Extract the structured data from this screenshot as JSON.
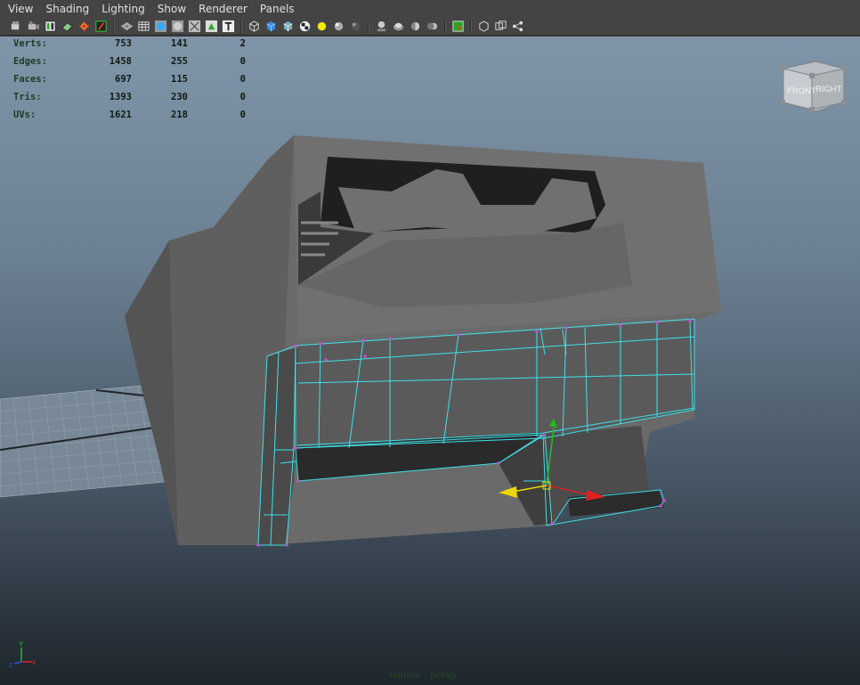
{
  "menu": {
    "items": [
      {
        "id": "view",
        "label": "View"
      },
      {
        "id": "shading",
        "label": "Shading"
      },
      {
        "id": "lighting",
        "label": "Lighting"
      },
      {
        "id": "show",
        "label": "Show"
      },
      {
        "id": "renderer",
        "label": "Renderer"
      },
      {
        "id": "panels",
        "label": "Panels"
      }
    ]
  },
  "toolbar": {
    "icons": [
      "camera-select-icon",
      "camera-attributes-icon",
      "bookmark-icon",
      "image-plane-icon",
      "grid-pivot-icon",
      "film-gate-icon",
      "wireframe-icon",
      "grid-toggle-icon",
      "smooth-shade-icon",
      "flat-shade-icon",
      "xray-icon",
      "textured-icon",
      "text-icon",
      "cube-wire-icon",
      "cube-shaded-icon",
      "cube-textured-icon",
      "checker-icon",
      "light-bulb-icon",
      "sphere-lit-icon",
      "sphere-dark-icon",
      "isolate-icon",
      "shadows-icon",
      "ambient-occlusion-icon",
      "motion-blur-icon",
      "select-camera-icon",
      "single-view-icon",
      "two-views-icon",
      "share-icon"
    ]
  },
  "hud": {
    "rows": [
      {
        "label": "Verts:",
        "c1": "753",
        "c2": "141",
        "c3": "2"
      },
      {
        "label": "Edges:",
        "c1": "1458",
        "c2": "255",
        "c3": "0"
      },
      {
        "label": "Faces:",
        "c1": "697",
        "c2": "115",
        "c3": "0"
      },
      {
        "label": "Tris:",
        "c1": "1393",
        "c2": "230",
        "c3": "0"
      },
      {
        "label": "UVs:",
        "c1": "1621",
        "c2": "218",
        "c3": "0"
      }
    ]
  },
  "viewcube": {
    "front_label": "FRONT",
    "right_label": "RIGHT"
  },
  "axis": {
    "y": "Y",
    "z": "z",
    "x": "x"
  },
  "status": {
    "isolate": "Isolate : persp"
  },
  "colors": {
    "wireframe": "#3fe0e8",
    "vertex": "#c050d0",
    "manipulator_x": "#e02020",
    "manipulator_y": "#20c020",
    "manipulator_z": "#e8d800"
  }
}
